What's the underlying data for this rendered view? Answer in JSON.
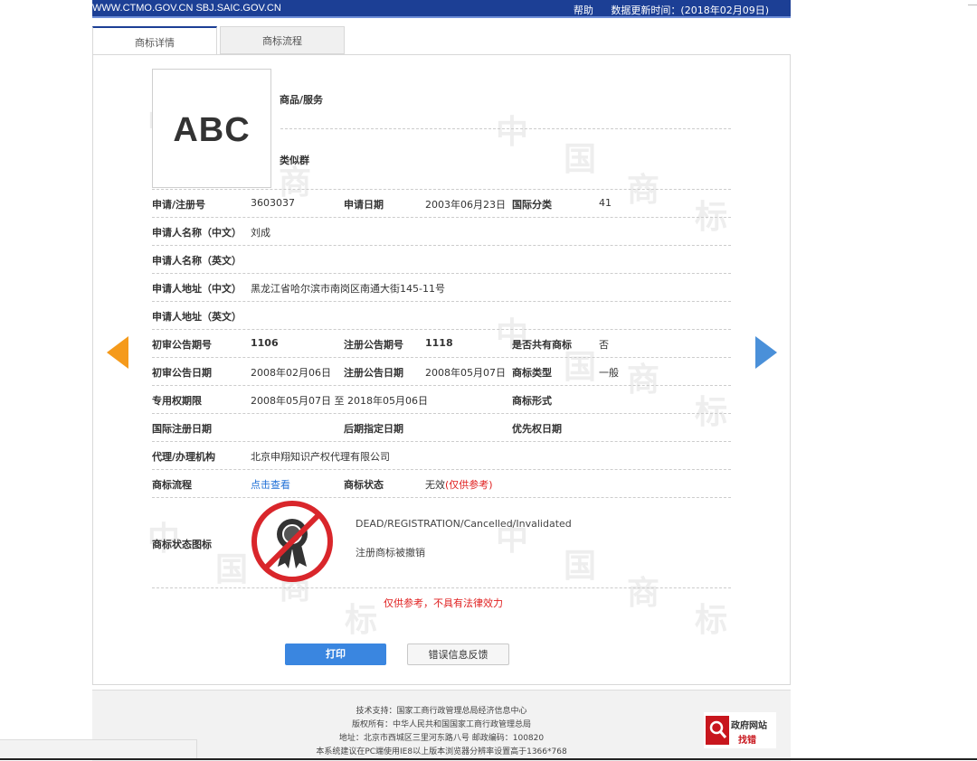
{
  "header": {
    "site_links": "WWW.CTMO.GOV.CN SBJ.SAIC.GOV.CN",
    "help": "帮助",
    "update_time": "数据更新时间：(2018年02月09日)"
  },
  "tabs": [
    "商标详情",
    "商标流程"
  ],
  "logo": {
    "text": "ABC"
  },
  "goods_label": "商品/服务",
  "similar_group_label": "类似群",
  "fields": {
    "reg_no_label": "申请/注册号",
    "reg_no": "3603037",
    "app_date_label": "申请日期",
    "app_date": "2003年06月23日",
    "intl_class_label": "国际分类",
    "intl_class": "41",
    "applicant_cn_label": "申请人名称（中文）",
    "applicant_cn": "刘成",
    "applicant_en_label": "申请人名称（英文）",
    "address_cn_label": "申请人地址（中文）",
    "address_cn": "黑龙江省哈尔滨市南岗区南通大街145-11号",
    "address_en_label": "申请人地址（英文）",
    "prelim_no_label": "初审公告期号",
    "prelim_no": "1106",
    "reg_pub_no_label": "注册公告期号",
    "reg_pub_no": "1118",
    "shared_label": "是否共有商标",
    "shared": "否",
    "prelim_date_label": "初审公告日期",
    "prelim_date": "2008年02月06日",
    "reg_pub_date_label": "注册公告日期",
    "reg_pub_date": "2008年05月07日",
    "tm_type_label": "商标类型",
    "tm_type": "一般",
    "exclusive_label": "专用权期限",
    "exclusive": "2008年05月07日 至 2018年05月06日",
    "tm_form_label": "商标形式",
    "intl_reg_date_label": "国际注册日期",
    "later_date_label": "后期指定日期",
    "priority_date_label": "优先权日期",
    "agent_label": "代理/办理机构",
    "agent": "北京申翔知识产权代理有限公司",
    "flow_label": "商标流程",
    "flow_link": "点击查看",
    "status_label": "商标状态",
    "status": "无效",
    "status_note": "(仅供参考)"
  },
  "status_icon": {
    "label": "商标状态图标",
    "en": "DEAD/REGISTRATION/Cancelled/Invalidated",
    "cn": "注册商标被撤销",
    "icon": "cancelled-seal-icon",
    "color": "#d9262b"
  },
  "disclaimer": "仅供参考，不具有法律效力",
  "buttons": {
    "print": "打印",
    "feedback": "错误信息反馈"
  },
  "watermark": [
    "中",
    "国",
    "商",
    "标"
  ],
  "footer": {
    "line1": "技术支持：国家工商行政管理总局经济信息中心",
    "line2": "版权所有：中华人民共和国国家工商行政管理总局",
    "line3": "地址：北京市西城区三里河东路八号  邮政编码：100820",
    "line4": "本系统建议在PC端使用IE8以上版本浏览器分辨率设置高于1366*768"
  },
  "gov_badge": {
    "line1": "政府网站",
    "line2": "找错"
  },
  "colors": {
    "brand": "#1c3f95",
    "link": "#1f6fd6",
    "print_button": "#3a86e0",
    "prev_arrow": "#f59a1b",
    "next_arrow": "#4a90d9"
  }
}
